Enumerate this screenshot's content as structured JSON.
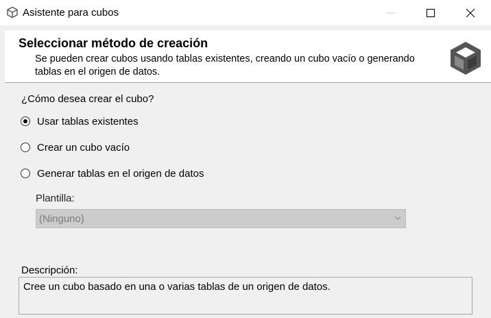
{
  "window": {
    "title": "Asistente para cubos",
    "icon": "cube-icon",
    "controls": [
      "minimize-icon",
      "maximize-icon",
      "close-icon"
    ]
  },
  "header": {
    "title": "Seleccionar método de creación",
    "description": "Se pueden crear cubos usando tablas existentes, creando un cubo vacío o generando tablas en el origen de datos.",
    "icon": "cube-icon"
  },
  "form": {
    "question": "¿Cómo desea crear el cubo?",
    "options": [
      {
        "label": "Usar tablas existentes",
        "selected": true
      },
      {
        "label": "Crear un cubo vacío",
        "selected": false
      },
      {
        "label": "Generar tablas en el origen de datos",
        "selected": false
      }
    ],
    "template": {
      "label": "Plantilla:",
      "value": "(Ninguno)",
      "enabled": false
    },
    "description": {
      "label": "Descripción:",
      "text": "Cree un cubo basado en una o varias tablas de un origen de datos."
    }
  },
  "colors": {
    "window_bg": "#f0f0f0",
    "header_bg": "#ffffff",
    "disabled_field": "#cccccc",
    "icon_gray": "#555555"
  }
}
